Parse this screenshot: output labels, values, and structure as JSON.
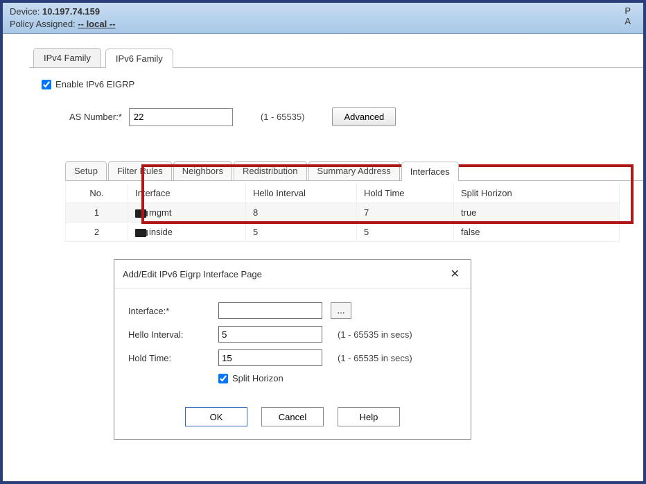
{
  "header": {
    "device_label": "Device:",
    "device_value": "10.197.74.159",
    "policy_label": "Policy Assigned:",
    "policy_value": "-- local --",
    "right_top": "P",
    "right_bottom": "A"
  },
  "family_tabs": {
    "ipv4": "IPv4 Family",
    "ipv6": "IPv6 Family"
  },
  "enable": {
    "label": "Enable IPv6 EIGRP",
    "checked": true
  },
  "as": {
    "label": "AS Number:*",
    "value": "22",
    "range": "(1 - 65535)",
    "advanced_btn": "Advanced"
  },
  "subtabs": [
    "Setup",
    "Filter Rules",
    "Neighbors",
    "Redistribution",
    "Summary Address",
    "Interfaces"
  ],
  "table": {
    "headers": {
      "no": "No.",
      "iface": "Interface",
      "hello": "Hello Interval",
      "hold": "Hold Time",
      "split": "Split Horizon"
    },
    "rows": [
      {
        "no": "1",
        "iface": "mgmt",
        "hello": "8",
        "hold": "7",
        "split": "true"
      },
      {
        "no": "2",
        "iface": "inside",
        "hello": "5",
        "hold": "5",
        "split": "false"
      }
    ]
  },
  "dialog": {
    "title": "Add/Edit IPv6 Eigrp Interface Page",
    "iface_label": "Interface:*",
    "iface_value": "",
    "browse": "...",
    "hello_label": "Hello Interval:",
    "hello_value": "5",
    "hello_hint": "(1 - 65535 in secs)",
    "hold_label": "Hold Time:",
    "hold_value": "15",
    "hold_hint": "(1 - 65535 in secs)",
    "split_label": "Split Horizon",
    "split_checked": true,
    "ok": "OK",
    "cancel": "Cancel",
    "help": "Help"
  }
}
